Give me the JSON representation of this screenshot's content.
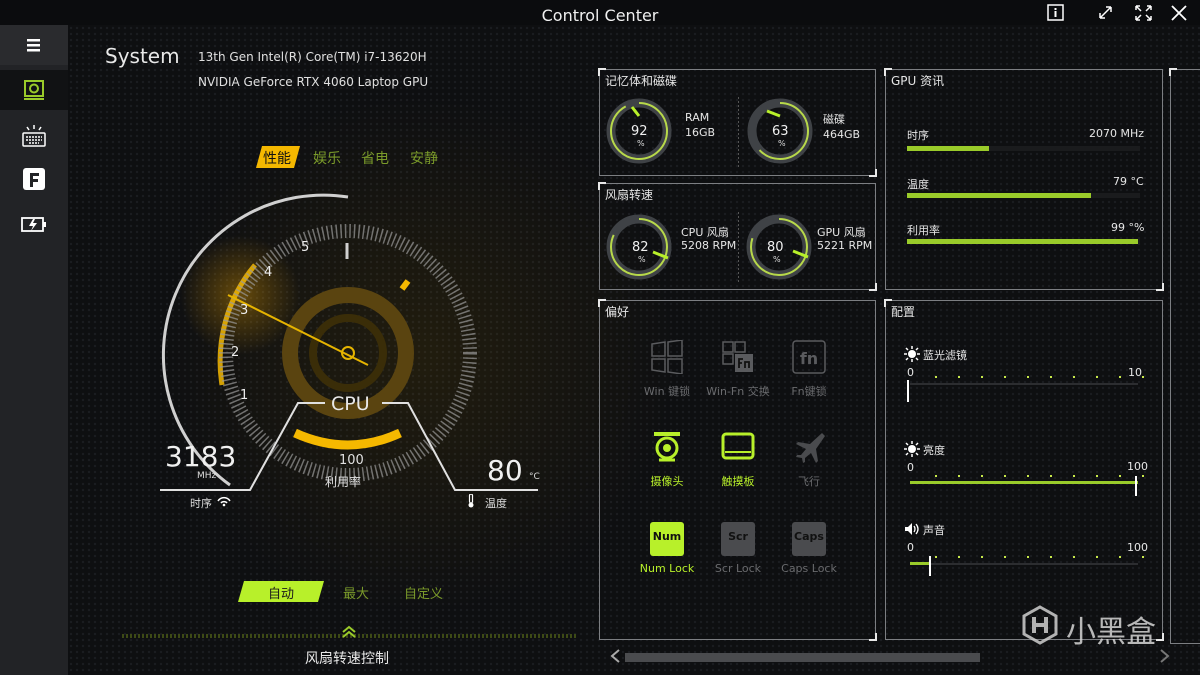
{
  "app": {
    "title": "Control Center"
  },
  "sidebar": {
    "items": [
      "menu-icon",
      "cpu-icon",
      "keyboard-icon",
      "f-icon",
      "battery-icon"
    ]
  },
  "system": {
    "label": "System",
    "cpu_model": "13th Gen Intel(R) Core(TM) i7-13620H",
    "gpu_model": "NVIDIA GeForce RTX 4060 Laptop GPU"
  },
  "modes": {
    "items": [
      "性能",
      "娱乐",
      "省电",
      "安静"
    ],
    "active": "性能"
  },
  "cpu_gauge": {
    "label": "CPU",
    "ticks": [
      "1",
      "2",
      "3",
      "4",
      "5"
    ],
    "clock_value": "3183",
    "clock_unit": "MHz",
    "clock_label": "时序",
    "usage_value": "100",
    "usage_label": "利用率",
    "temp_value": "80",
    "temp_unit": "°C",
    "temp_label": "温度"
  },
  "fan_control": {
    "modes": [
      "自动",
      "最大",
      "自定义"
    ],
    "active": "自动",
    "title": "风扇转速控制"
  },
  "memory": {
    "title": "记忆体和磁碟",
    "ram": {
      "value": "92",
      "unit": "%",
      "label": "RAM",
      "size": "16GB"
    },
    "disk": {
      "value": "63",
      "unit": "%",
      "label": "磁碟",
      "size": "464GB"
    }
  },
  "fan_speed": {
    "title": "风扇转速",
    "cpu": {
      "value": "82",
      "unit": "%",
      "label": "CPU 风扇",
      "rpm": "5208 RPM"
    },
    "gpu": {
      "value": "80",
      "unit": "%",
      "label": "GPU 风扇",
      "rpm": "5221 RPM"
    }
  },
  "gpu_info": {
    "title": "GPU 资讯",
    "rows": [
      {
        "label": "时序",
        "value": "2070 MHz",
        "fill": 0.35
      },
      {
        "label": "温度",
        "value": "79 °C",
        "fill": 0.79
      },
      {
        "label": "利用率",
        "value": "99 °%",
        "fill": 0.99
      }
    ]
  },
  "preferences": {
    "title": "偏好",
    "items": [
      {
        "label": "Win 键锁",
        "on": false
      },
      {
        "label": "Win-Fn 交换",
        "on": false
      },
      {
        "label": "Fn键锁",
        "on": false
      },
      {
        "label": "摄像头",
        "on": true
      },
      {
        "label": "触摸板",
        "on": true
      },
      {
        "label": "飞行",
        "on": false
      },
      {
        "label": "Num Lock",
        "on": true
      },
      {
        "label": "Scr Lock",
        "on": false
      },
      {
        "label": "Caps Lock",
        "on": false
      }
    ],
    "key_caps": [
      "Num",
      "Scr",
      "Caps",
      "fn"
    ]
  },
  "config": {
    "title": "配置",
    "sliders": [
      {
        "label": "蓝光滤镜",
        "min": "0",
        "max": "10",
        "level": 0.0
      },
      {
        "label": "亮度",
        "min": "0",
        "max": "100",
        "level": 1.0
      },
      {
        "label": "声音",
        "min": "0",
        "max": "100",
        "level": 0.09
      }
    ]
  },
  "watermark": "小黑盒",
  "colors": {
    "accent_green": "#9acb2a",
    "accent_yellow": "#f5b800",
    "bright_green": "#b8f02a"
  }
}
